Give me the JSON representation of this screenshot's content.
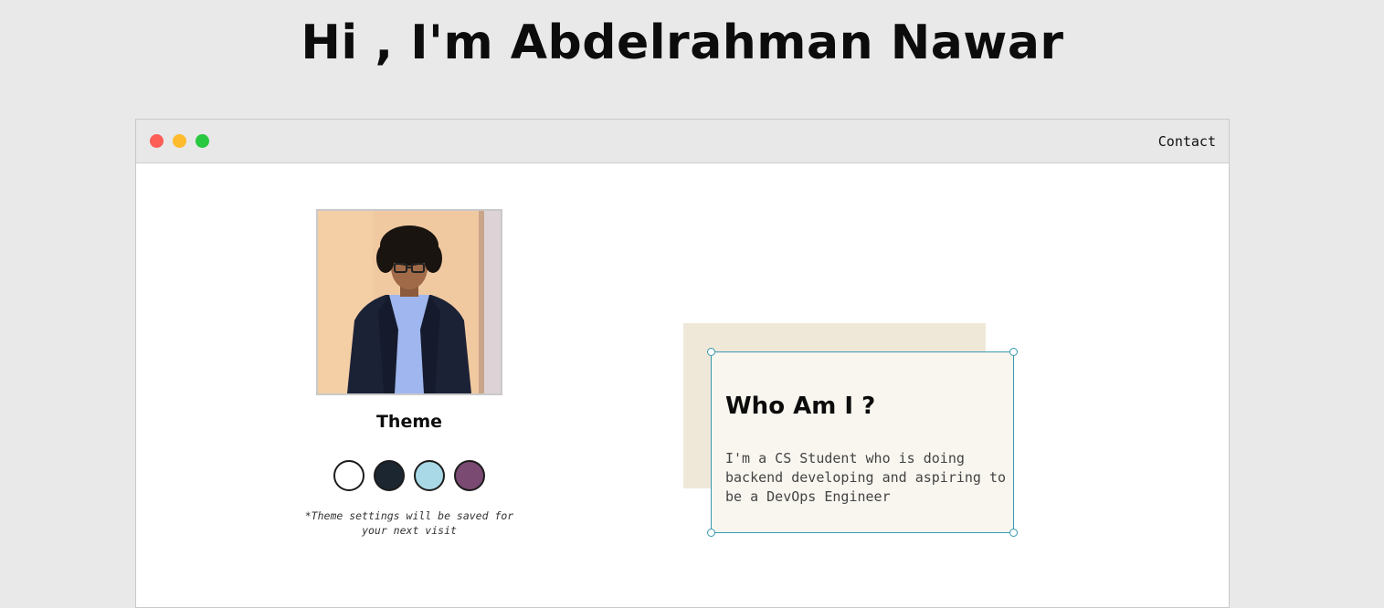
{
  "header": {
    "title": "Hi , I'm Abdelrahman Nawar"
  },
  "window": {
    "controls": [
      "close-dot",
      "minimize-dot",
      "maximize-dot"
    ],
    "colors": {
      "close": "#fd5e56",
      "minimize": "#febb2d",
      "maximize": "#28c840"
    },
    "nav": {
      "contact_label": "Contact"
    }
  },
  "profile": {
    "photo_alt": "Profile photo"
  },
  "theme": {
    "heading": "Theme",
    "swatches": [
      {
        "name": "light",
        "color": "#ffffff"
      },
      {
        "name": "dark",
        "color": "#1b2631"
      },
      {
        "name": "blue",
        "color": "#a9d8e6"
      },
      {
        "name": "purple",
        "color": "#7a4a72"
      }
    ],
    "note": "*Theme settings will be saved for your next visit"
  },
  "about": {
    "title": "Who Am I ?",
    "text": "I'm a CS Student who is doing backend developing and aspiring to be a DevOps Engineer",
    "accent_color": "#3a9ab0"
  }
}
